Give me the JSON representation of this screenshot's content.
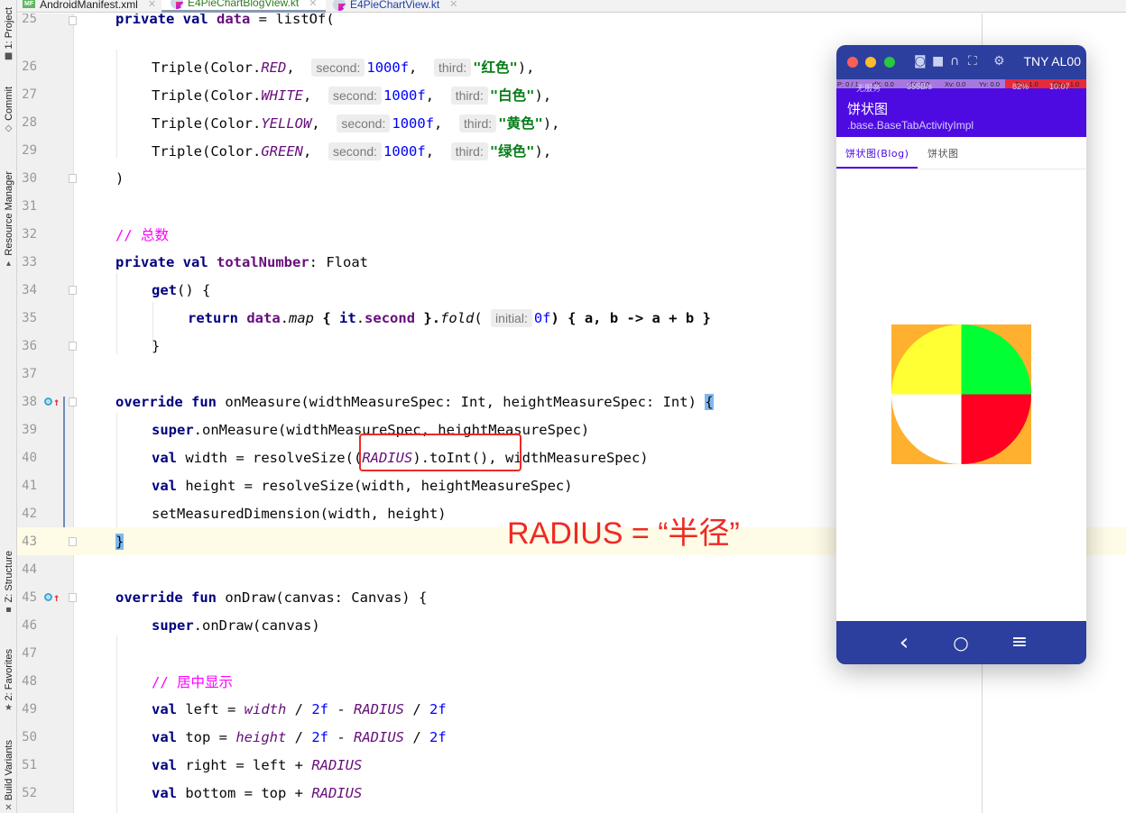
{
  "tool_stripe": {
    "top": [
      {
        "label": "1: Project",
        "icon": "folder-icon"
      },
      {
        "label": "Commit",
        "icon": "commit-icon"
      },
      {
        "label": "Resource Manager",
        "icon": "resource-manager-icon"
      }
    ],
    "bottom": [
      {
        "label": "Z: Structure",
        "icon": "structure-icon"
      },
      {
        "label": "2: Favorites",
        "icon": "star-icon"
      },
      {
        "label": "Build Variants",
        "icon": "build-variants-icon"
      }
    ]
  },
  "tabs": [
    {
      "label": "AndroidManifest.xml",
      "icon": "manifest-file-icon",
      "badge": "MF",
      "active": false
    },
    {
      "label": "E4PieChartBlogView.kt",
      "icon": "kotlin-file-icon",
      "active": true
    },
    {
      "label": "E4PieChartView.kt",
      "icon": "kotlin-file-icon",
      "active": false
    }
  ],
  "editor": {
    "lines": [
      {
        "n": "25",
        "partial": true
      },
      {
        "n": "26"
      },
      {
        "n": "27"
      },
      {
        "n": "28"
      },
      {
        "n": "29"
      },
      {
        "n": "30"
      },
      {
        "n": "31"
      },
      {
        "n": "32"
      },
      {
        "n": "33"
      },
      {
        "n": "34"
      },
      {
        "n": "35"
      },
      {
        "n": "36"
      },
      {
        "n": "37"
      },
      {
        "n": "38"
      },
      {
        "n": "39"
      },
      {
        "n": "40"
      },
      {
        "n": "41"
      },
      {
        "n": "42"
      },
      {
        "n": "43"
      },
      {
        "n": "44"
      },
      {
        "n": "45"
      },
      {
        "n": "46"
      },
      {
        "n": "47"
      },
      {
        "n": "48"
      },
      {
        "n": "49"
      },
      {
        "n": "50"
      },
      {
        "n": "51"
      },
      {
        "n": "52"
      }
    ],
    "tokens": {
      "l25": {
        "private": "private",
        "val": "val",
        "data": "data",
        "rest": " = listOf("
      },
      "triple": "Triple(Color.",
      "second_hint": "second:",
      "third_hint": "third:",
      "value": "1000f",
      "rows": [
        {
          "color": "RED",
          "label": "\"红色\""
        },
        {
          "color": "WHITE",
          "label": "\"白色\""
        },
        {
          "color": "YELLOW",
          "label": "\"黄色\""
        },
        {
          "color": "GREEN",
          "label": "\"绿色\""
        }
      ],
      "close_paren": ")",
      "comment_total": "// 总数",
      "l33": {
        "private": "private",
        "val": "val",
        "name": "totalNumber",
        "type": ": Float"
      },
      "l34": {
        "get": "get",
        "rest": "() {"
      },
      "l35": {
        "return": "return",
        "data": "data",
        "dot": ".",
        "map": "map",
        "brace1": " { ",
        "it": "it",
        "dot2": ".",
        "second": "second",
        "brace2": " }.",
        "fold": "fold",
        "paren": "(",
        "hint": "initial:",
        "zero": "0f",
        "rest": ") { a, b -> a + b }"
      },
      "close_brace": "}",
      "l38": {
        "override": "override",
        "fun": "fun",
        "sig": " onMeasure(widthMeasureSpec: Int, heightMeasureSpec: Int) ",
        "brace": "{"
      },
      "l39": {
        "super": "super",
        "rest": ".onMeasure(widthMeasureSpec, heightMeasureSpec)"
      },
      "l40": {
        "val": "val",
        "a": " width = resolveSize((",
        "radius": "RADIUS",
        "b": ").toInt(), widthMeasureSpec)"
      },
      "l41": {
        "val": "val",
        "rest": " height = resolveSize(width, heightMeasureSpec)"
      },
      "l42": "setMeasuredDimension(width, height)",
      "l45": {
        "override": "override",
        "fun": "fun",
        "sig": " onDraw(canvas: Canvas) {"
      },
      "l46": {
        "super": "super",
        "rest": ".onDraw(canvas)"
      },
      "comment_center": "// 居中显示",
      "l49": {
        "val": "val",
        "a": " left = ",
        "width": "width",
        "b": " / ",
        "two": "2f",
        "c": " - ",
        "radius": "RADIUS",
        "d": " / ",
        "two2": "2f"
      },
      "l50": {
        "val": "val",
        "a": " top = ",
        "height": "height",
        "b": " / ",
        "two": "2f",
        "c": " - ",
        "radius": "RADIUS",
        "d": " / ",
        "two2": "2f"
      },
      "l51": {
        "val": "val",
        "a": " right = left + ",
        "radius": "RADIUS"
      },
      "l52": {
        "val": "val",
        "a": " bottom = top + ",
        "radius": "RADIUS"
      }
    }
  },
  "annotation": {
    "text": "RADIUS = “半径”",
    "color": "#ee2a24"
  },
  "emulator": {
    "device_name": "TNY AL00",
    "toolbar_icons": [
      "camera-icon",
      "video-icon",
      "headphones-icon",
      "fullscreen-icon",
      "settings-icon"
    ],
    "pointer_bar": {
      "p": "P: 0 / 1",
      "dx": "dX: 0.0",
      "dy": "dY: 0.0",
      "xv": "Xv: 0.0",
      "yv": "Yv: 0.0",
      "prs": "Prs: 1.0",
      "size": "Size: 1.0"
    },
    "status_bar": {
      "carrier": "无服务",
      "speed": "355B/s",
      "battery": "82%",
      "time": "10:07"
    },
    "app_bar": {
      "title": "饼状图",
      "subtitle": ".base.BaseTabActivityImpl",
      "color": "#4d0be2"
    },
    "tabs": [
      {
        "label": "饼状图(Blog)",
        "active": true
      },
      {
        "label": "饼状图",
        "active": false
      }
    ],
    "nav": [
      "back-icon",
      "home-icon",
      "menu-icon"
    ],
    "nav_glyphs": {
      "back": "‹",
      "home": "○",
      "menu": "≡"
    }
  },
  "chart_data": {
    "type": "pie",
    "title": "",
    "categories": [
      "红色",
      "白色",
      "黄色",
      "绿色"
    ],
    "values": [
      1000,
      1000,
      1000,
      1000
    ],
    "colors": [
      "#ff0022",
      "#ffffff",
      "#ffff33",
      "#00ff33"
    ],
    "background": "#ffb02e",
    "start_angle_deg": 0,
    "direction": "clockwise"
  }
}
